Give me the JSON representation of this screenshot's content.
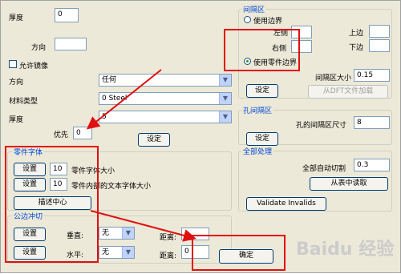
{
  "left": {
    "thickness_label": "厚度",
    "thickness_value": "0",
    "direction_label_top": "方向",
    "allow_mirror_label": "允许镜像",
    "direction_label": "方向",
    "direction_value": "任何",
    "material_label": "材料类型",
    "material_value": "0  Steel",
    "thickness2_label": "厚度",
    "thickness2_value": "5",
    "priority_label": "优先",
    "priority_value": "0",
    "set_button": "设定"
  },
  "part_font": {
    "title": "零件字体",
    "set1": "设置",
    "size1_value": "10",
    "size1_label": "零件字体大小",
    "set2": "设置",
    "size2_value": "10",
    "size2_label": "零件内部的文本字体大小",
    "desc_center": "描述中心"
  },
  "common_cut": {
    "title": "公边冲切",
    "set1": "设置",
    "vertical_label": "垂直:",
    "vertical_value": "无",
    "distance1_label": "距离:",
    "distance1_value": "",
    "set2": "设置",
    "horizontal_label": "水平:",
    "horizontal_value": "无",
    "distance2_label": "距离:",
    "distance2_value": "0"
  },
  "spacing": {
    "title": "间隔区",
    "use_boundary": "使用边界",
    "left_label": "左侧",
    "right_label": "右侧",
    "top_label": "上边",
    "bottom_label": "下边",
    "use_part_boundary": "使用零件边界",
    "size_label": "间隔区大小",
    "size_value": "0.15",
    "set_button": "设定",
    "dft_button": "从DFT文件加载"
  },
  "hole": {
    "title": "孔间隔区",
    "size_label": "孔的间隔区尺寸",
    "size_value": "8",
    "set_button": "设定"
  },
  "all": {
    "title": "全部处理",
    "auto_cut_label": "全部自动切割",
    "auto_cut_value": "0.3",
    "read_table": "从表中读取",
    "validate": "Validate Invalids"
  },
  "ok_button": "确定",
  "watermark": "Baidu 经验",
  "colors": {
    "annotation": "#e01010",
    "group_title": "#0046d5",
    "dialog_bg": "#ece9d8"
  }
}
